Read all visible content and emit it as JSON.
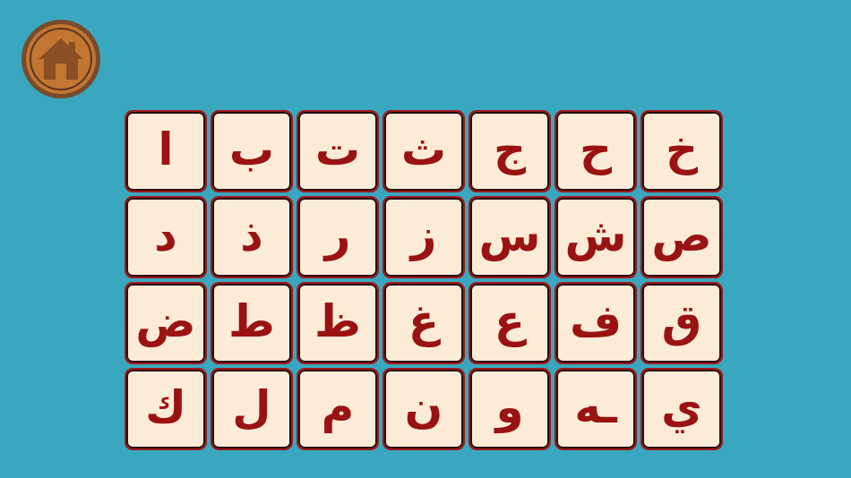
{
  "colors": {
    "background": "#3aa7c0",
    "tile_fill": "#fcebd6",
    "letter": "#9a1212",
    "home_fill": "#c27631",
    "home_border": "#7a4a2c",
    "home_icon": "#8a4f22"
  },
  "home_button": {
    "icon": "house-icon"
  },
  "letter_grid": {
    "rows": [
      [
        "ا",
        "ب",
        "ت",
        "ث",
        "ج",
        "ح",
        "خ"
      ],
      [
        "د",
        "ذ",
        "ر",
        "ز",
        "س",
        "ش",
        "ص"
      ],
      [
        "ض",
        "ط",
        "ظ",
        "غ",
        "ع",
        "ف",
        "ق"
      ],
      [
        "ك",
        "ل",
        "م",
        "ن",
        "و",
        "ـه",
        "ي"
      ]
    ]
  }
}
